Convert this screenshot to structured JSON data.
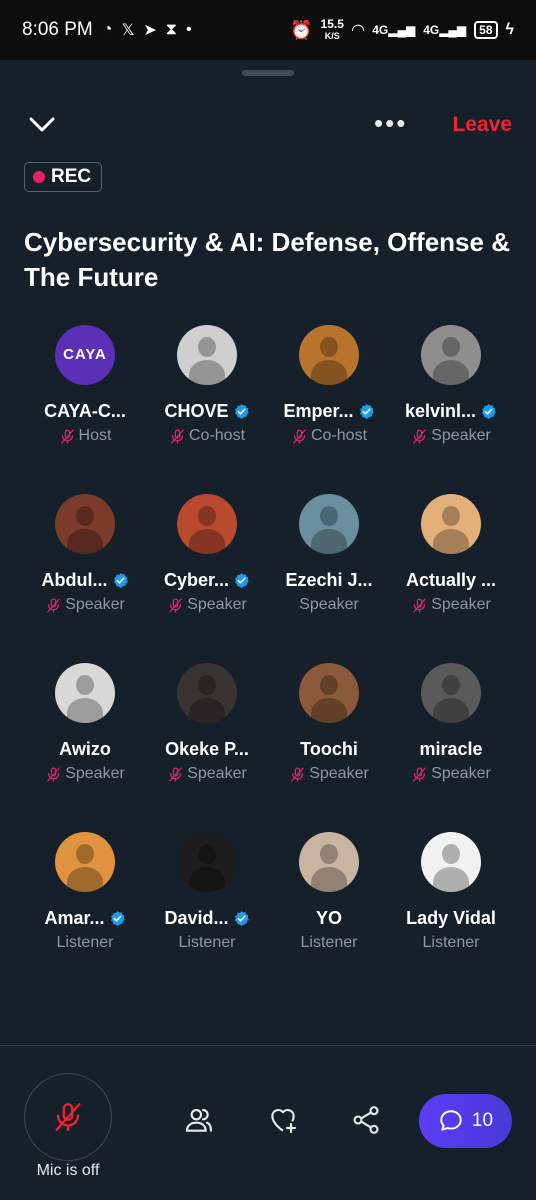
{
  "status_bar": {
    "time": "8:06 PM",
    "net_speed": "15.5",
    "net_unit": "K/S",
    "net1": "4G",
    "net2": "4G",
    "battery": "58"
  },
  "header": {
    "leave_label": "Leave",
    "rec_label": "REC"
  },
  "space": {
    "title": "Cybersecurity & AI: Defense, Offense & The Future"
  },
  "participants": [
    {
      "name": "CAYA-C...",
      "role": "Host",
      "verified": false,
      "muted": true,
      "avatar_color": "#5b2fb6",
      "avatar_text": "CAYA"
    },
    {
      "name": "CHOVE",
      "role": "Co-host",
      "verified": true,
      "muted": true,
      "avatar_color": "#cfcfcf"
    },
    {
      "name": "Emper...",
      "role": "Co-host",
      "verified": true,
      "muted": true,
      "avatar_color": "#b8742c"
    },
    {
      "name": "kelvinl...",
      "role": "Speaker",
      "verified": true,
      "muted": true,
      "avatar_color": "#8e8e8e"
    },
    {
      "name": "Abdul...",
      "role": "Speaker",
      "verified": true,
      "muted": true,
      "avatar_color": "#7a3b2a"
    },
    {
      "name": "Cyber...",
      "role": "Speaker",
      "verified": true,
      "muted": true,
      "avatar_color": "#b94a2e"
    },
    {
      "name": "Ezechi J...",
      "role": "Speaker",
      "verified": false,
      "muted": false,
      "avatar_color": "#6c8fa0"
    },
    {
      "name": "Actually ...",
      "role": "Speaker",
      "verified": false,
      "muted": true,
      "avatar_color": "#e3b07a"
    },
    {
      "name": "Awizo",
      "role": "Speaker",
      "verified": false,
      "muted": true,
      "avatar_color": "#d8d8d8"
    },
    {
      "name": "Okeke P...",
      "role": "Speaker",
      "verified": false,
      "muted": true,
      "avatar_color": "#3a3430"
    },
    {
      "name": "Toochi",
      "role": "Speaker",
      "verified": false,
      "muted": true,
      "avatar_color": "#8a5a3a"
    },
    {
      "name": "miracle",
      "role": "Speaker",
      "verified": false,
      "muted": true,
      "avatar_color": "#5a5a5a"
    },
    {
      "name": "Amar...",
      "role": "Listener",
      "verified": true,
      "muted": false,
      "avatar_color": "#e0923e"
    },
    {
      "name": "David...",
      "role": "Listener",
      "verified": true,
      "muted": false,
      "avatar_color": "#1d1d1d"
    },
    {
      "name": "YO",
      "role": "Listener",
      "verified": false,
      "muted": false,
      "avatar_color": "#c9b4a0"
    },
    {
      "name": "Lady Vidal",
      "role": "Listener",
      "verified": false,
      "muted": false,
      "avatar_color": "#f1f1f1"
    }
  ],
  "partial_avatars": [
    "#3a4a5a",
    "#b57b86",
    "#dcdcdc",
    "#12203a"
  ],
  "bottom_bar": {
    "mic_label": "Mic is off",
    "chat_count": "10"
  },
  "colors": {
    "background": "#15202b",
    "leave": "#f4212e",
    "rec_dot": "#e8206a",
    "verified": "#1d9bf0",
    "muted_icon": "#e8206a",
    "chat_button": "#5b3df5"
  }
}
